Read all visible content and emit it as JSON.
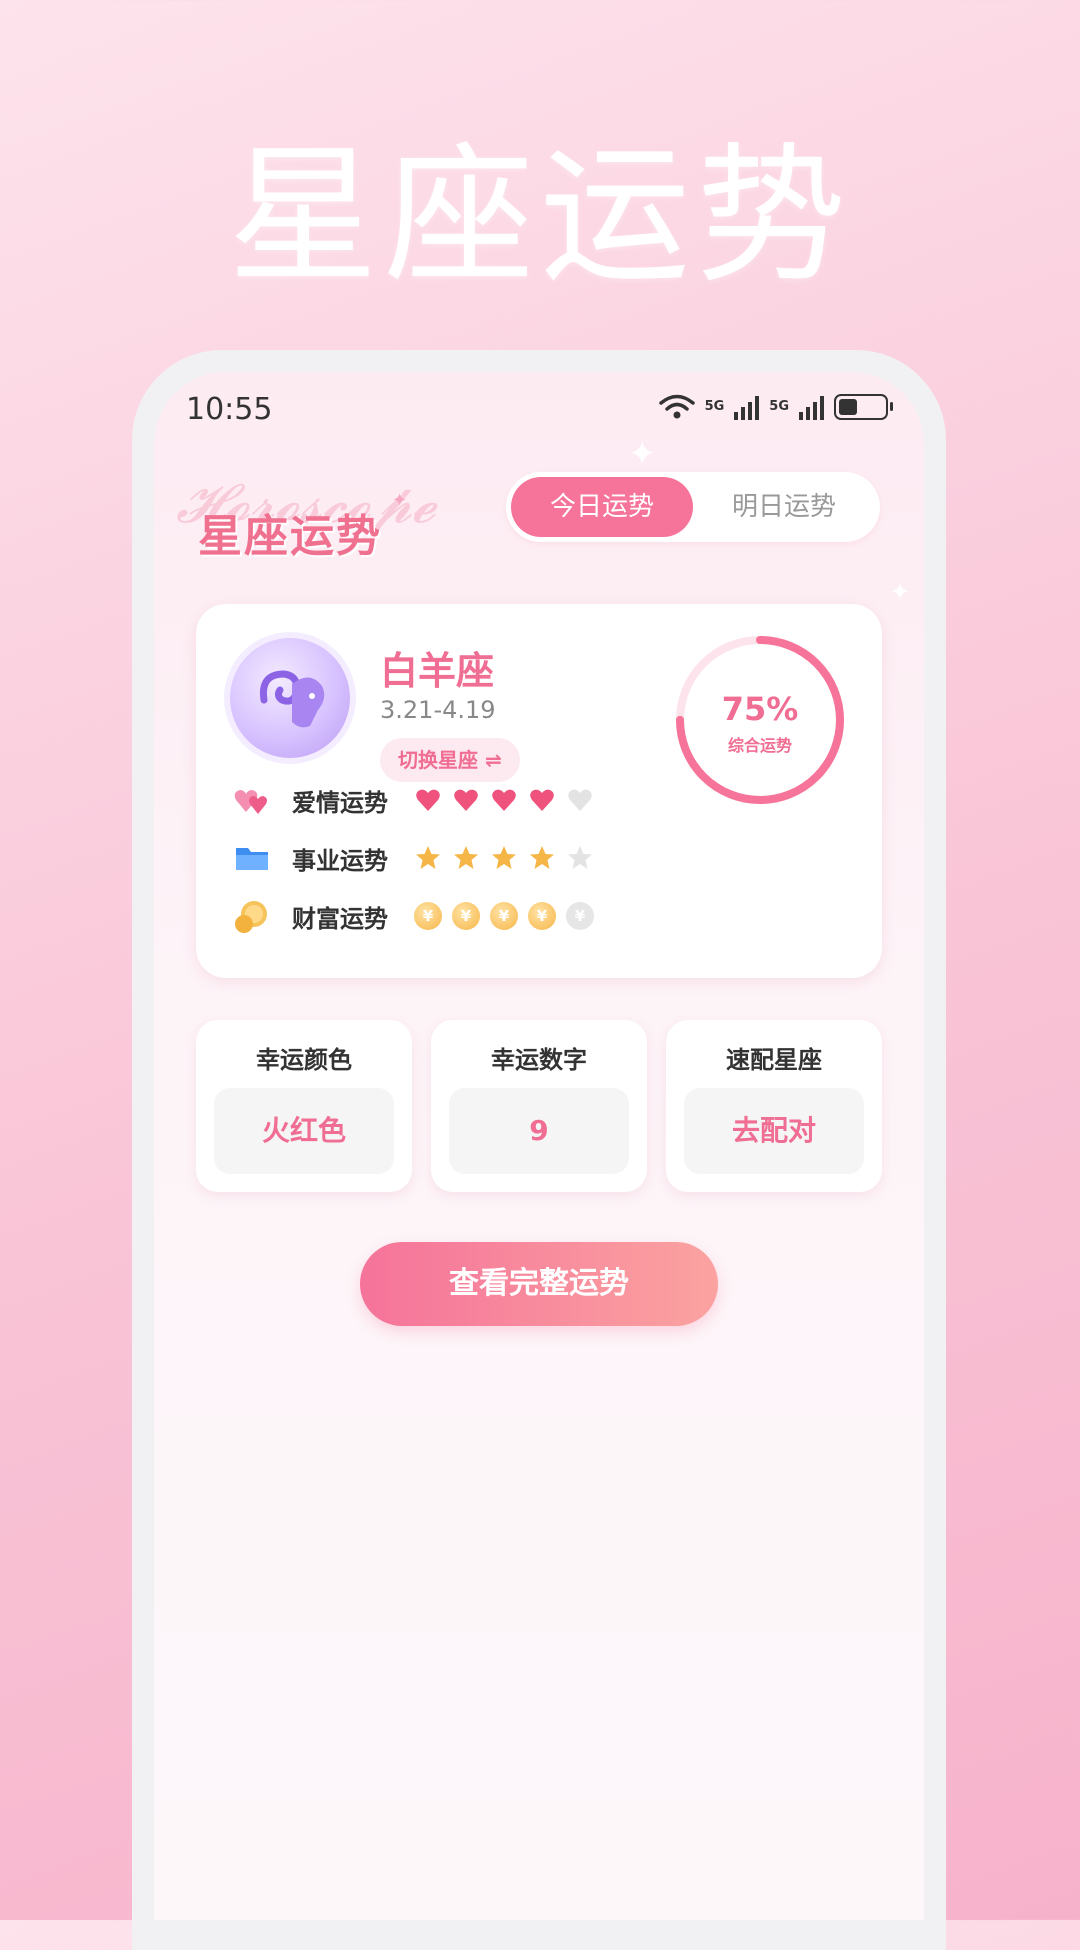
{
  "hero": {
    "title": "星座运势"
  },
  "status_bar": {
    "time": "10:55",
    "network_1": "5G",
    "network_2": "5G"
  },
  "app": {
    "title": "星座运势",
    "tabs": [
      {
        "label": "今日运势",
        "active": true
      },
      {
        "label": "明日运势",
        "active": false
      }
    ]
  },
  "sign_card": {
    "name": "白羊座",
    "date_range": "3.21-4.19",
    "switch_label": "切换星座 ⇌",
    "overall": {
      "percent_text": "75%",
      "value": 0.75,
      "label": "综合运势"
    },
    "rows": [
      {
        "label": "爱情运势",
        "icon": "hearts-icon",
        "rating": 4,
        "max": 5
      },
      {
        "label": "事业运势",
        "icon": "folder-icon",
        "rating": 4,
        "max": 5
      },
      {
        "label": "财富运势",
        "icon": "coins-icon",
        "rating": 4,
        "max": 5,
        "coin_symbol": "¥"
      }
    ]
  },
  "mini_cards": [
    {
      "title": "幸运颜色",
      "value": "火红色"
    },
    {
      "title": "幸运数字",
      "value": "9"
    },
    {
      "title": "速配星座",
      "value": "去配对"
    }
  ],
  "cta": {
    "label": "查看完整运势"
  },
  "colors": {
    "accent": "#f6739a",
    "star": "#f6b547",
    "background": "#f9c4d6"
  }
}
